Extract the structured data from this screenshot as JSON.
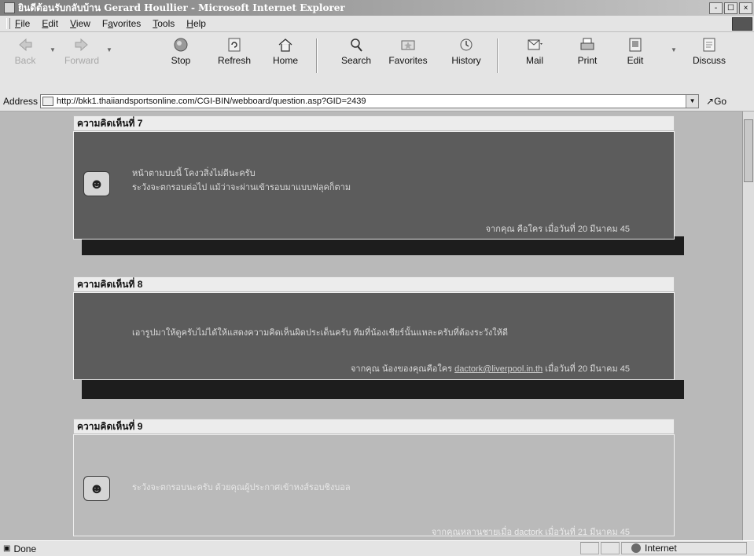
{
  "window": {
    "title": "ยินดีต้อนรับกลับบ้าน Gerard Houllier - Microsoft Internet Explorer",
    "controls": [
      "-",
      "☐",
      "×"
    ]
  },
  "menu": {
    "items": [
      {
        "pre": "",
        "key": "F",
        "rest": "ile"
      },
      {
        "pre": "",
        "key": "E",
        "rest": "dit"
      },
      {
        "pre": "",
        "key": "V",
        "rest": "iew"
      },
      {
        "pre": "F",
        "key": "a",
        "rest": "vorites"
      },
      {
        "pre": "",
        "key": "T",
        "rest": "ools"
      },
      {
        "pre": "",
        "key": "H",
        "rest": "elp"
      }
    ]
  },
  "toolbar": {
    "back": "Back",
    "forward": "Forward",
    "stop": "Stop",
    "refresh": "Refresh",
    "home": "Home",
    "search": "Search",
    "favorites": "Favorites",
    "history": "History",
    "mail": "Mail",
    "print": "Print",
    "edit": "Edit",
    "discuss": "Discuss"
  },
  "address": {
    "label": "Address",
    "url": "http://bkk1.thaiiandsportsonline.com/CGI-BIN/webboard/question.asp?GID=2439",
    "go": "Go"
  },
  "comments": [
    {
      "header": "ความคิดเห็นที่ 7",
      "line1": "หน้าตามบบนี้ โคงวสิ่งไม่ดีนะครับ",
      "line2": "ระวังจะตกรอบต่อไป แม้ว่าจะผ่านเข้ารอบมาแบบฟลุคก็ตาม",
      "signature": "จากคุณ คือใคร เมื่อวันที่ 20 มีนาคม 45"
    },
    {
      "header": "ความคิดเห็นที่ 8",
      "line1": "เอารูปมาให้ดูครับไม่ได้ให้แสดงความคิดเห็นผิดประเด็นครับ ทีมที่น้องเชียร์นั้นแหละครับที่ต้องระวังให้ดี",
      "sig_prefix": "จากคุณ น้องของคุณคือใคร",
      "sig_email": "dactork@liverpool.in.th",
      "sig_suffix": "เมื่อวันที่ 20 มีนาคม 45"
    },
    {
      "header": "ความคิดเห็นที่ 9",
      "line1": "ระวังจะตกรอบนะครับ ด้วยคุณผู้ประกาศเข้าหงส์รอบชิงบอล",
      "signature": "จากคุณหลานชายเมื่อ dactork เมื่อวันที่ 21 มีนาคม 45"
    }
  ],
  "status": {
    "text": "Done",
    "zone": "Internet"
  }
}
